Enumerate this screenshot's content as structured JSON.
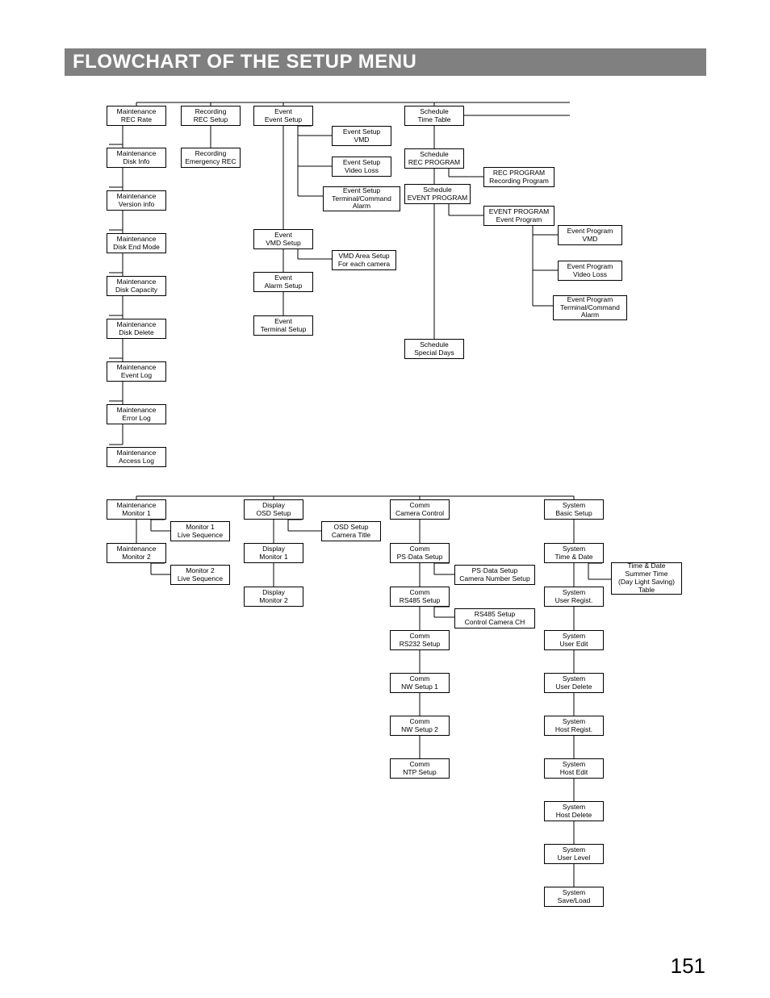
{
  "title": "FLOWCHART OF THE SETUP MENU",
  "page_number": "151",
  "nodes": {
    "m_rec_rate": {
      "l1": "Maintenance",
      "l2": "REC Rate"
    },
    "m_disk_info": {
      "l1": "Maintenance",
      "l2": "Disk Info"
    },
    "m_version": {
      "l1": "Maintenance",
      "l2": "Version info"
    },
    "m_disk_end": {
      "l1": "Maintenance",
      "l2": "Disk End Mode"
    },
    "m_disk_cap": {
      "l1": "Maintenance",
      "l2": "Disk Capacity"
    },
    "m_disk_del": {
      "l1": "Maintenance",
      "l2": "Disk Delete"
    },
    "m_event_log": {
      "l1": "Maintenance",
      "l2": "Event Log"
    },
    "m_error_log": {
      "l1": "Maintenance",
      "l2": "Error Log"
    },
    "m_access_log": {
      "l1": "Maintenance",
      "l2": "Access Log"
    },
    "r_rec_setup": {
      "l1": "Recording",
      "l2": "REC Setup"
    },
    "r_emergency": {
      "l1": "Recording",
      "l2": "Emergency REC"
    },
    "e_event": {
      "l1": "Event",
      "l2": "Event Setup"
    },
    "e_vmd": {
      "l1": "Event",
      "l2": "VMD Setup"
    },
    "e_alarm": {
      "l1": "Event",
      "l2": "Alarm Setup"
    },
    "e_terminal": {
      "l1": "Event",
      "l2": "Terminal Setup"
    },
    "es_vmd": {
      "l1": "Event Setup",
      "l2": "VMD"
    },
    "es_video": {
      "l1": "Event Setup",
      "l2": "Video Loss"
    },
    "es_term": {
      "l1": "Event Setup",
      "l2": "Terminal/Command",
      "l3": "Alarm"
    },
    "vmd_area": {
      "l1": "VMD Area Setup",
      "l2": "For each camera"
    },
    "s_time": {
      "l1": "Schedule",
      "l2": "Time Table"
    },
    "s_recprog": {
      "l1": "Schedule",
      "l2": "REC PROGRAM"
    },
    "s_evtprog": {
      "l1": "Schedule",
      "l2": "EVENT PROGRAM"
    },
    "s_special": {
      "l1": "Schedule",
      "l2": "Special Days"
    },
    "rp": {
      "l1": "REC PROGRAM",
      "l2": "Recording Program"
    },
    "ep": {
      "l1": "EVENT PROGRAM",
      "l2": "Event Program"
    },
    "ep_vmd": {
      "l1": "Event Program",
      "l2": "VMD"
    },
    "ep_video": {
      "l1": "Event Program",
      "l2": "Video Loss"
    },
    "ep_term": {
      "l1": "Event Program",
      "l2": "Terminal/Command",
      "l3": "Alarm"
    },
    "m_mon1": {
      "l1": "Maintenance",
      "l2": "Monitor 1"
    },
    "m_mon2": {
      "l1": "Maintenance",
      "l2": "Monitor 2"
    },
    "mon1_seq": {
      "l1": "Monitor 1",
      "l2": "Live Sequence"
    },
    "mon2_seq": {
      "l1": "Monitor 2",
      "l2": "Live Sequence"
    },
    "d_osd": {
      "l1": "Display",
      "l2": "OSD Setup"
    },
    "d_mon1": {
      "l1": "Display",
      "l2": "Monitor 1"
    },
    "d_mon2": {
      "l1": "Display",
      "l2": "Monitor 2"
    },
    "osd_title": {
      "l1": "OSD Setup",
      "l2": "Camera Title"
    },
    "c_camctrl": {
      "l1": "Comm",
      "l2": "Camera Control"
    },
    "c_psdata": {
      "l1": "Comm",
      "l2": "PS·Data Setup"
    },
    "c_rs485": {
      "l1": "Comm",
      "l2": "RS485 Setup"
    },
    "c_rs232": {
      "l1": "Comm",
      "l2": "RS232 Setup"
    },
    "c_nw1": {
      "l1": "Comm",
      "l2": "NW Setup 1"
    },
    "c_nw2": {
      "l1": "Comm",
      "l2": "NW Setup 2"
    },
    "c_ntp": {
      "l1": "Comm",
      "l2": "NTP Setup"
    },
    "ps_setup": {
      "l1": "PS·Data Setup",
      "l2": "Camera Number Setup"
    },
    "rs485_setup": {
      "l1": "RS485 Setup",
      "l2": "Control Camera CH"
    },
    "sys_basic": {
      "l1": "System",
      "l2": "Basic Setup"
    },
    "sys_time": {
      "l1": "System",
      "l2": "Time & Date"
    },
    "sys_ureg": {
      "l1": "System",
      "l2": "User Regist."
    },
    "sys_uedit": {
      "l1": "System",
      "l2": "User Edit"
    },
    "sys_udel": {
      "l1": "System",
      "l2": "User Delete"
    },
    "sys_hreg": {
      "l1": "System",
      "l2": "Host Regist."
    },
    "sys_hedit": {
      "l1": "System",
      "l2": "Host Edit"
    },
    "sys_hdel": {
      "l1": "System",
      "l2": "Host Delete"
    },
    "sys_ulevel": {
      "l1": "System",
      "l2": "User Level"
    },
    "sys_save": {
      "l1": "System",
      "l2": "Save/Load"
    },
    "td_summer": {
      "l1": "Time & Date",
      "l2": "Summer Time",
      "l3": "(Day Light Saving)",
      "l4": "Table"
    }
  }
}
